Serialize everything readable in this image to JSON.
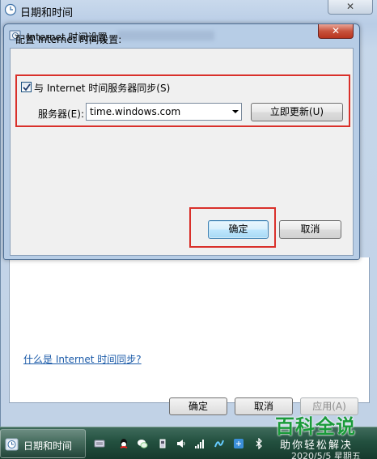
{
  "outer_window": {
    "title": "日期和时间",
    "link": "什么是 Internet 时间同步?",
    "ok_label": "确定",
    "cancel_label": "取消",
    "apply_label": "应用(A)"
  },
  "dialog": {
    "title": "Internet 时间设置",
    "section_label": "配置 Internet 时间设置:",
    "sync_checkbox": {
      "label": "与 Internet 时间服务器同步(S)",
      "checked": true
    },
    "server_label": "服务器(E):",
    "server_value": "time.windows.com",
    "update_now_label": "立即更新(U)",
    "ok_label": "确定",
    "cancel_label": "取消"
  },
  "taskbar": {
    "task_label": "日期和时间",
    "date_text": "2020/5/5 星期五",
    "tray_icons": [
      "keyboard-icon",
      "qq-icon",
      "wechat-icon",
      "usb-icon",
      "volume-icon",
      "signal-icon",
      "network-icon",
      "app-icon",
      "bluetooth-icon"
    ]
  },
  "watermark": {
    "title": "百科全说",
    "subtitle": "助你轻松解决"
  }
}
